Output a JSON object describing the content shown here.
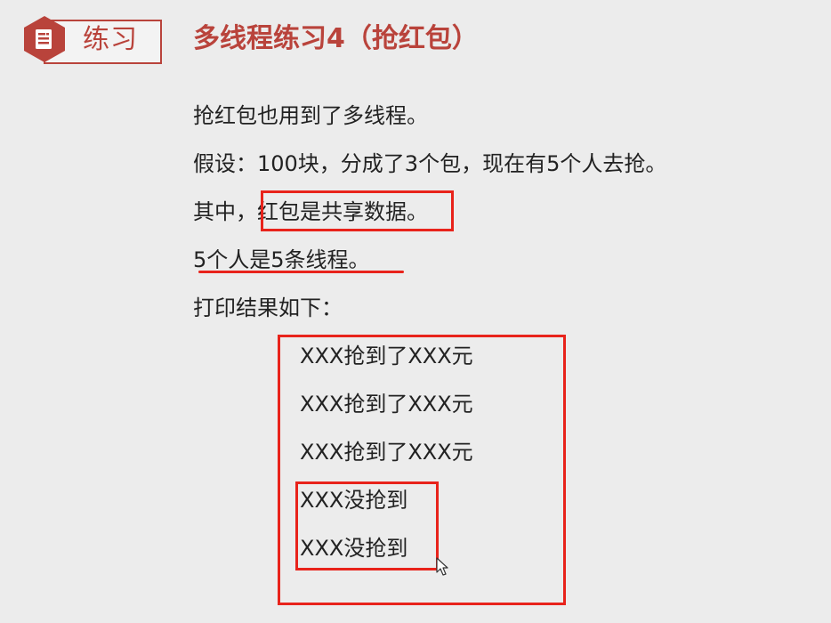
{
  "header": {
    "badge_label": "练习",
    "badge_icon": "document-icon",
    "title": "多线程练习4（抢红包）"
  },
  "body": {
    "lines": [
      "抢红包也用到了多线程。",
      "假设：100块，分成了3个包，现在有5个人去抢。",
      "其中，红包是共享数据。",
      "5个人是5条线程。",
      "打印结果如下："
    ]
  },
  "results": [
    "XXX抢到了XXX元",
    "XXX抢到了XXX元",
    "XXX抢到了XXX元",
    "XXX没抢到",
    "XXX没抢到"
  ],
  "colors": {
    "accent": "#b9433b",
    "highlight": "#e8231b",
    "background": "#ececec"
  }
}
